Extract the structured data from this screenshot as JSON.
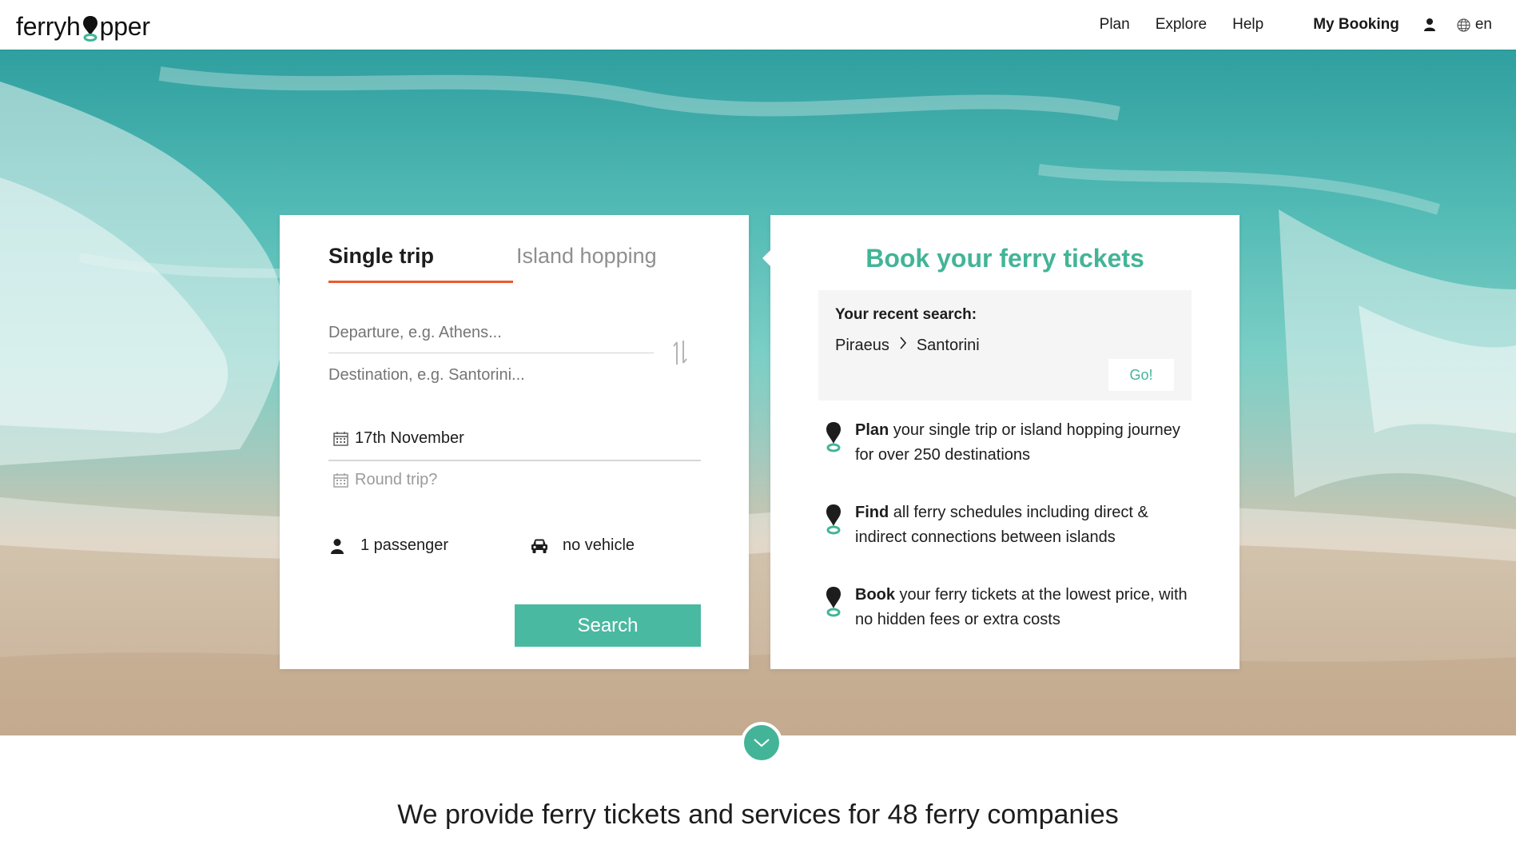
{
  "header": {
    "logo_left": "ferryh",
    "logo_right": "pper",
    "nav": [
      "Plan",
      "Explore",
      "Help"
    ],
    "my_booking": "My Booking",
    "language": "en"
  },
  "search": {
    "tabs": {
      "single": "Single trip",
      "hopping": "Island hopping"
    },
    "departure_placeholder": "Departure, e.g. Athens...",
    "destination_placeholder": "Destination, e.g. Santorini...",
    "date": "17th November",
    "round_trip": "Round trip?",
    "passengers": "1 passenger",
    "vehicle": "no vehicle",
    "button": "Search"
  },
  "info": {
    "title": "Book your ferry tickets",
    "recent_label": "Your recent search:",
    "recent_from": "Piraeus",
    "recent_to": "Santorini",
    "go": "Go!",
    "features": [
      {
        "bold": "Plan",
        "text": " your single trip or island hopping journey for over 250 destinations"
      },
      {
        "bold": "Find",
        "text": " all ferry schedules including direct & indirect connections between islands"
      },
      {
        "bold": "Book",
        "text": " your ferry tickets at the lowest price, with no hidden fees or extra costs"
      }
    ]
  },
  "footer_text": "We provide ferry tickets and services for 48 ferry companies",
  "colors": {
    "accent": "#43b497",
    "tab_underline": "#ea5a2b",
    "button": "#4ab9a1"
  },
  "icons": [
    "logo-pin-icon",
    "user-icon",
    "globe-icon",
    "swap-icon",
    "calendar-icon",
    "passenger-icon",
    "car-icon",
    "chevron-right-icon",
    "map-pin-icon",
    "chevron-down-icon"
  ]
}
